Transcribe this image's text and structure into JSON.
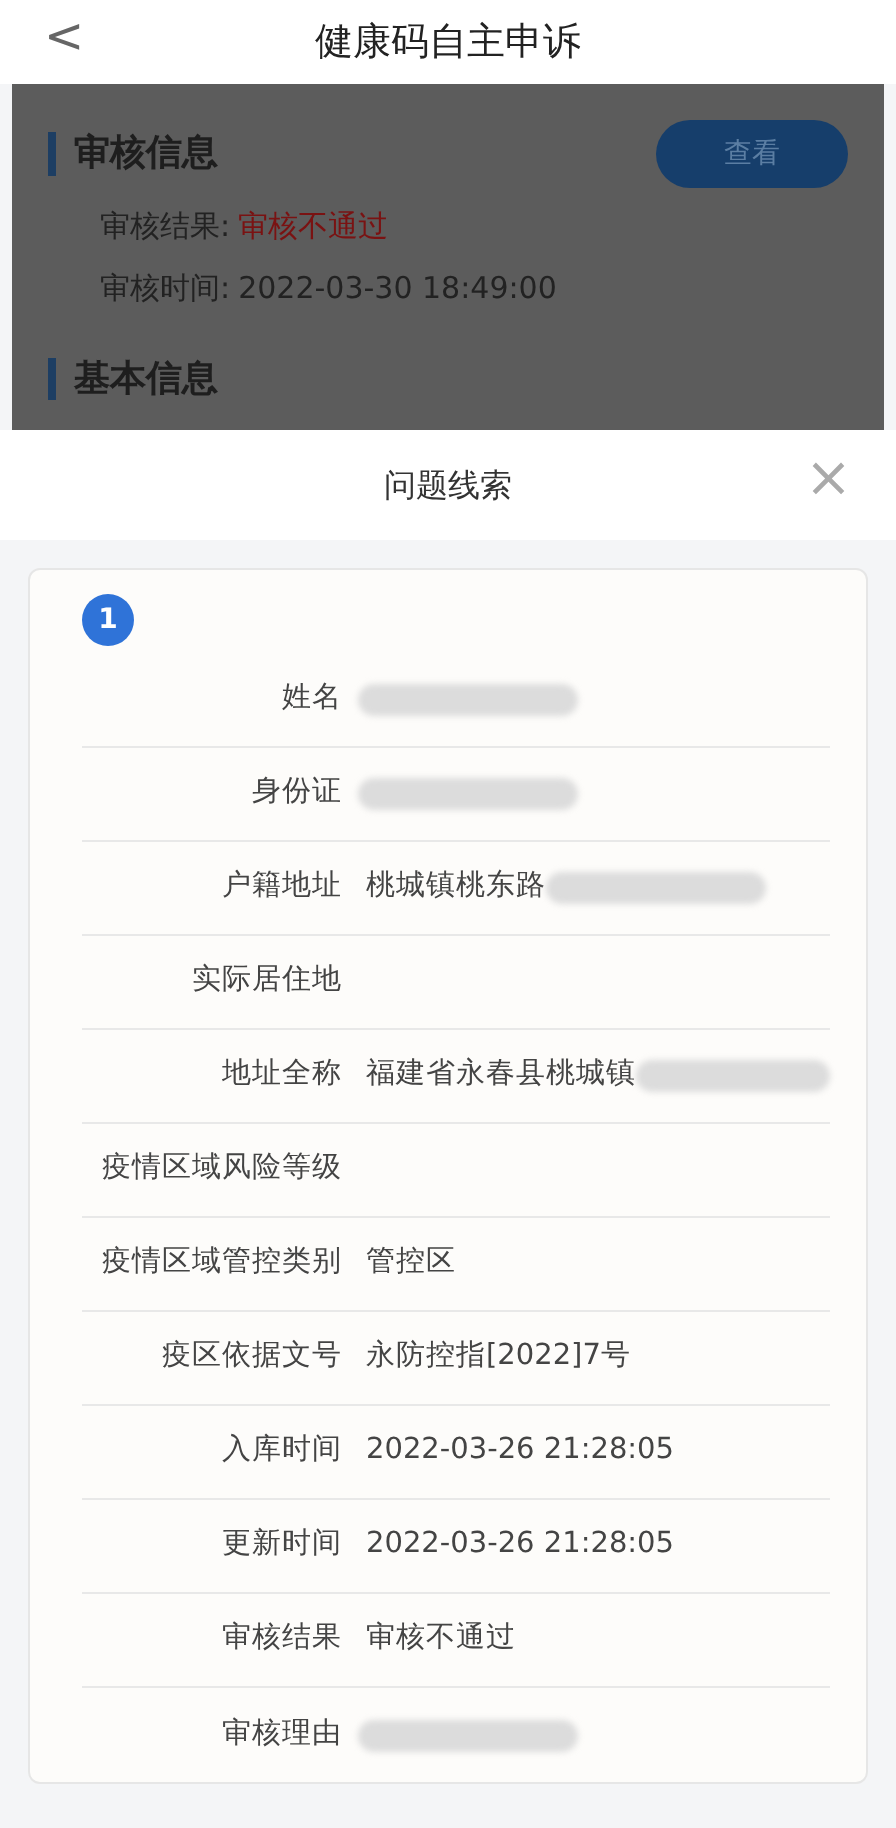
{
  "header": {
    "back": "<",
    "title": "健康码自主申诉"
  },
  "background": {
    "review_section": {
      "title": "审核信息",
      "button": "查看",
      "rows": [
        {
          "label": "审核结果:",
          "value": "审核不通过",
          "kind": "alert"
        },
        {
          "label": "审核时间:",
          "value": "2022-03-30 18:49:00",
          "kind": "plain"
        }
      ]
    },
    "basic_section": {
      "title": "基本信息"
    }
  },
  "sheet": {
    "title": "问题线索",
    "close": "×",
    "card": {
      "index": "1",
      "fields": [
        {
          "label": "姓名",
          "redacted": true
        },
        {
          "label": "身份证",
          "redacted": true
        },
        {
          "label": "户籍地址",
          "value": "桃城镇桃东路",
          "redacted": true
        },
        {
          "label": "实际居住地"
        },
        {
          "label": "地址全称",
          "value": "福建省永春县桃城镇",
          "redacted": true
        },
        {
          "label": "疫情区域风险等级"
        },
        {
          "label": "疫情区域管控类别",
          "value": "管控区"
        },
        {
          "label": "疫区依据文号",
          "value": "永防控指[2022]7号"
        },
        {
          "label": "入库时间",
          "value": "2022-03-26 21:28:05"
        },
        {
          "label": "更新时间",
          "value": "2022-03-26 21:28:05"
        },
        {
          "label": "审核结果",
          "value": "审核不通过"
        },
        {
          "label": "审核理由",
          "redacted": true
        }
      ]
    }
  }
}
